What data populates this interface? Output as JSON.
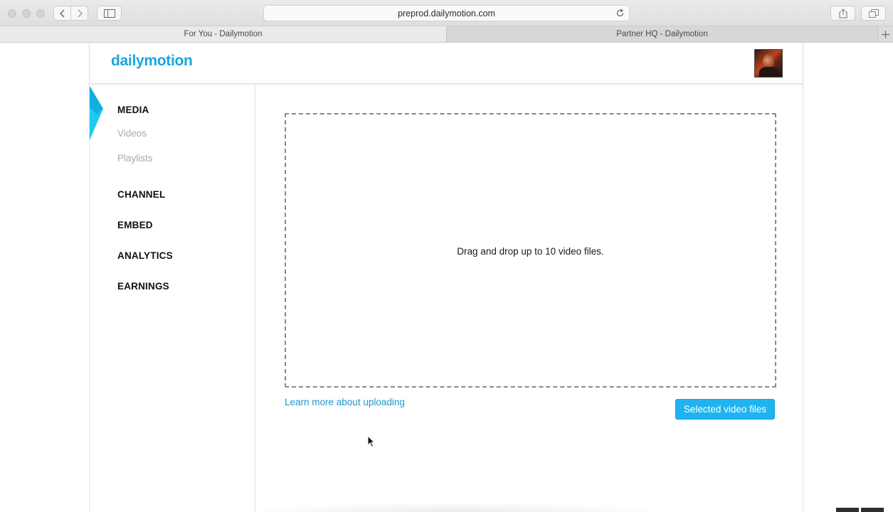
{
  "browser": {
    "url": "preprod.dailymotion.com",
    "tabs": [
      {
        "label": "For You - Dailymotion",
        "active": true
      },
      {
        "label": "Partner HQ - Dailymotion",
        "active": false
      }
    ],
    "icons": [
      "back-icon",
      "forward-icon",
      "sidebar-icon",
      "reload-icon",
      "share-icon",
      "tabs-overview-icon",
      "new-tab-icon"
    ]
  },
  "header": {
    "logo": "dailymotion",
    "brand_color": "#19a5e0"
  },
  "sidebar": {
    "accent_color": "#1fc6f0",
    "sections": [
      {
        "label": "MEDIA",
        "active": true,
        "items": [
          {
            "label": "Videos"
          },
          {
            "label": "Playlists"
          }
        ]
      },
      {
        "label": "CHANNEL"
      },
      {
        "label": "EMBED"
      },
      {
        "label": "ANALYTICS"
      },
      {
        "label": "EARNINGS"
      }
    ]
  },
  "upload": {
    "drop_text": "Drag and drop up to 10 video files.",
    "learn_more_link": "Learn more about uploading",
    "select_button": "Selected video files",
    "button_color": "#20b3ef"
  }
}
